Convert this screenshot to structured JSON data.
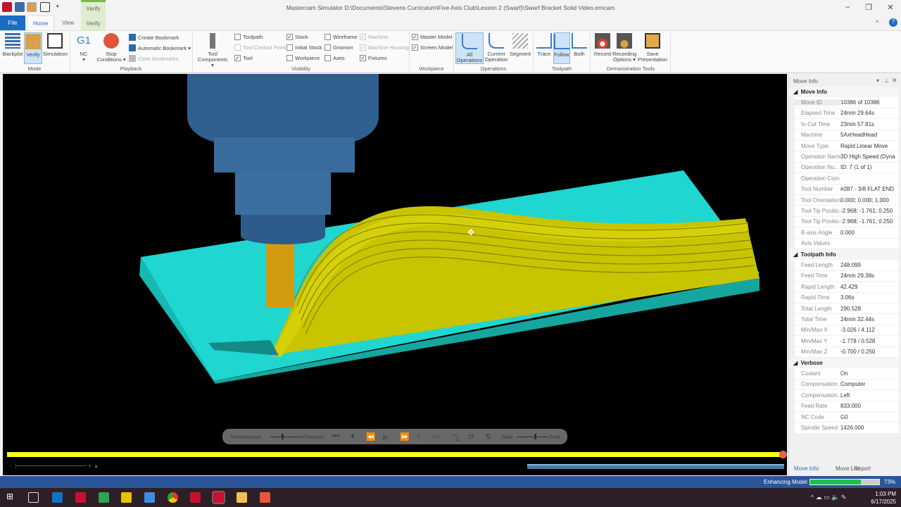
{
  "window": {
    "title": "Mastercam Simulator  D:\\Documents\\Stevens Curriculum\\Five Axis Club\\Lesson 2 (Swarf)\\Swarf Bracket Solid Video.emcam",
    "minimize": "–",
    "restore": "❐",
    "close": "✕"
  },
  "context_tab": {
    "group": "Verify",
    "tab": "Verify"
  },
  "tabs": {
    "file": "File",
    "home": "Home",
    "view": "View"
  },
  "ribbon": {
    "mode": {
      "label": "Mode",
      "backplot": "Backplot",
      "verify": "Verify",
      "simulation": "Simulation"
    },
    "playback": {
      "label": "Playback",
      "nc_icon": "G1",
      "nc": "NC",
      "stop": "Stop",
      "stop2": "Conditions ▾",
      "create_bookmark": "Create Bookmark",
      "automatic_bookmark": "Automatic Bookmark ▾",
      "clear_bookmarks": "Clear Bookmarks"
    },
    "tool_components": {
      "line1": "Tool",
      "line2": "Components ▾"
    },
    "visibility": {
      "label": "Visibility",
      "items": [
        {
          "label": "Toolpath",
          "checked": false
        },
        {
          "label": "Tool Contact Point",
          "checked": false,
          "disabled": true
        },
        {
          "label": "Tool",
          "checked": true
        },
        {
          "label": "Stock",
          "checked": true
        },
        {
          "label": "Initial Stock",
          "checked": false
        },
        {
          "label": "Workpiece",
          "checked": false
        },
        {
          "label": "Wireframe",
          "checked": false
        },
        {
          "label": "Gnomon",
          "checked": false
        },
        {
          "label": "Axes",
          "checked": false
        },
        {
          "label": "Machine",
          "checked": true,
          "disabled": true
        },
        {
          "label": "Machine Housing",
          "checked": true,
          "disabled": true
        },
        {
          "label": "Fixtures",
          "checked": true
        }
      ]
    },
    "workpiece": {
      "label": "Workpiece",
      "master_model": "Master Model",
      "screen_model": "Screen Model"
    },
    "operations": {
      "label": "Operations",
      "all1": "All",
      "all2": "Operations",
      "cur1": "Current",
      "cur2": "Operation",
      "segment": "Segment"
    },
    "toolpath": {
      "label": "Toolpath",
      "trace": "Trace",
      "follow": "Follow",
      "both": "Both"
    },
    "demo": {
      "label": "Demonstration Tools",
      "record": "Record",
      "rec_opt1": "Recording",
      "rec_opt2": "Options ▾",
      "save1": "Save",
      "save2": "Presentation"
    }
  },
  "playbar": {
    "performance": "Performance",
    "precision": "Precision",
    "slow": "Slow",
    "fast": "Fast",
    "progress": 1.0
  },
  "panel": {
    "title": "Move Info",
    "sections": [
      {
        "title": "Move Info",
        "rows": [
          [
            "Move ID",
            "10386 of 10386"
          ],
          [
            "Elapsed Time",
            "24min 29.64s"
          ],
          [
            "In-Cut Time",
            "23min 57.81s"
          ],
          [
            "Machine",
            "5AxHeadHead"
          ],
          [
            "Move Type",
            "Rapid Linear Move"
          ],
          [
            "Operation Name",
            "3D High Speed (Dyna"
          ],
          [
            "Operation Nu...",
            "ID: 7 (1 of 1)"
          ],
          [
            "Operation Com...",
            ""
          ],
          [
            "Tool Number",
            "#287 - 3/8 FLAT END"
          ],
          [
            "Tool Orientation",
            "0.000; 0.000; 1.000"
          ],
          [
            "Tool Tip Positio...",
            "-2.968; -1.761; 0.250"
          ],
          [
            "Tool Tip Positio...",
            "-2.968; -1.761; 0.250"
          ],
          [
            "B-axis Angle",
            "0.000"
          ],
          [
            "Axis Values",
            ""
          ]
        ]
      },
      {
        "title": "Toolpath Info",
        "rows": [
          [
            "Feed Length",
            "248.099"
          ],
          [
            "Feed Time",
            "24min 29.38s"
          ],
          [
            "Rapid Length",
            "42.429"
          ],
          [
            "Rapid Time",
            "3.06s"
          ],
          [
            "Total Length",
            "290.528"
          ],
          [
            "Total Time",
            "24min 32.44s"
          ],
          [
            "Min/Max X",
            "-3.026 / 4.112"
          ],
          [
            "Min/Max Y",
            "-1.778 / 0.528"
          ],
          [
            "Min/Max Z",
            "-0.700 / 0.250"
          ]
        ]
      },
      {
        "title": "Verbose",
        "rows": [
          [
            "Coolant",
            "On"
          ],
          [
            "Compensation...",
            "Computer"
          ],
          [
            "Compensation...",
            "Left"
          ],
          [
            "Feed Rate",
            "833.000"
          ],
          [
            "NC Code",
            "G0"
          ],
          [
            "Spindle Speed",
            "1426.000"
          ]
        ]
      }
    ],
    "tabs": [
      "Move Info",
      "Move List",
      "Report"
    ]
  },
  "status": {
    "label": "Enhancing Model",
    "percent": "73%",
    "progress": 0.73
  },
  "taskbar": {
    "time": "1:03 PM",
    "date": "6/17/2025"
  }
}
